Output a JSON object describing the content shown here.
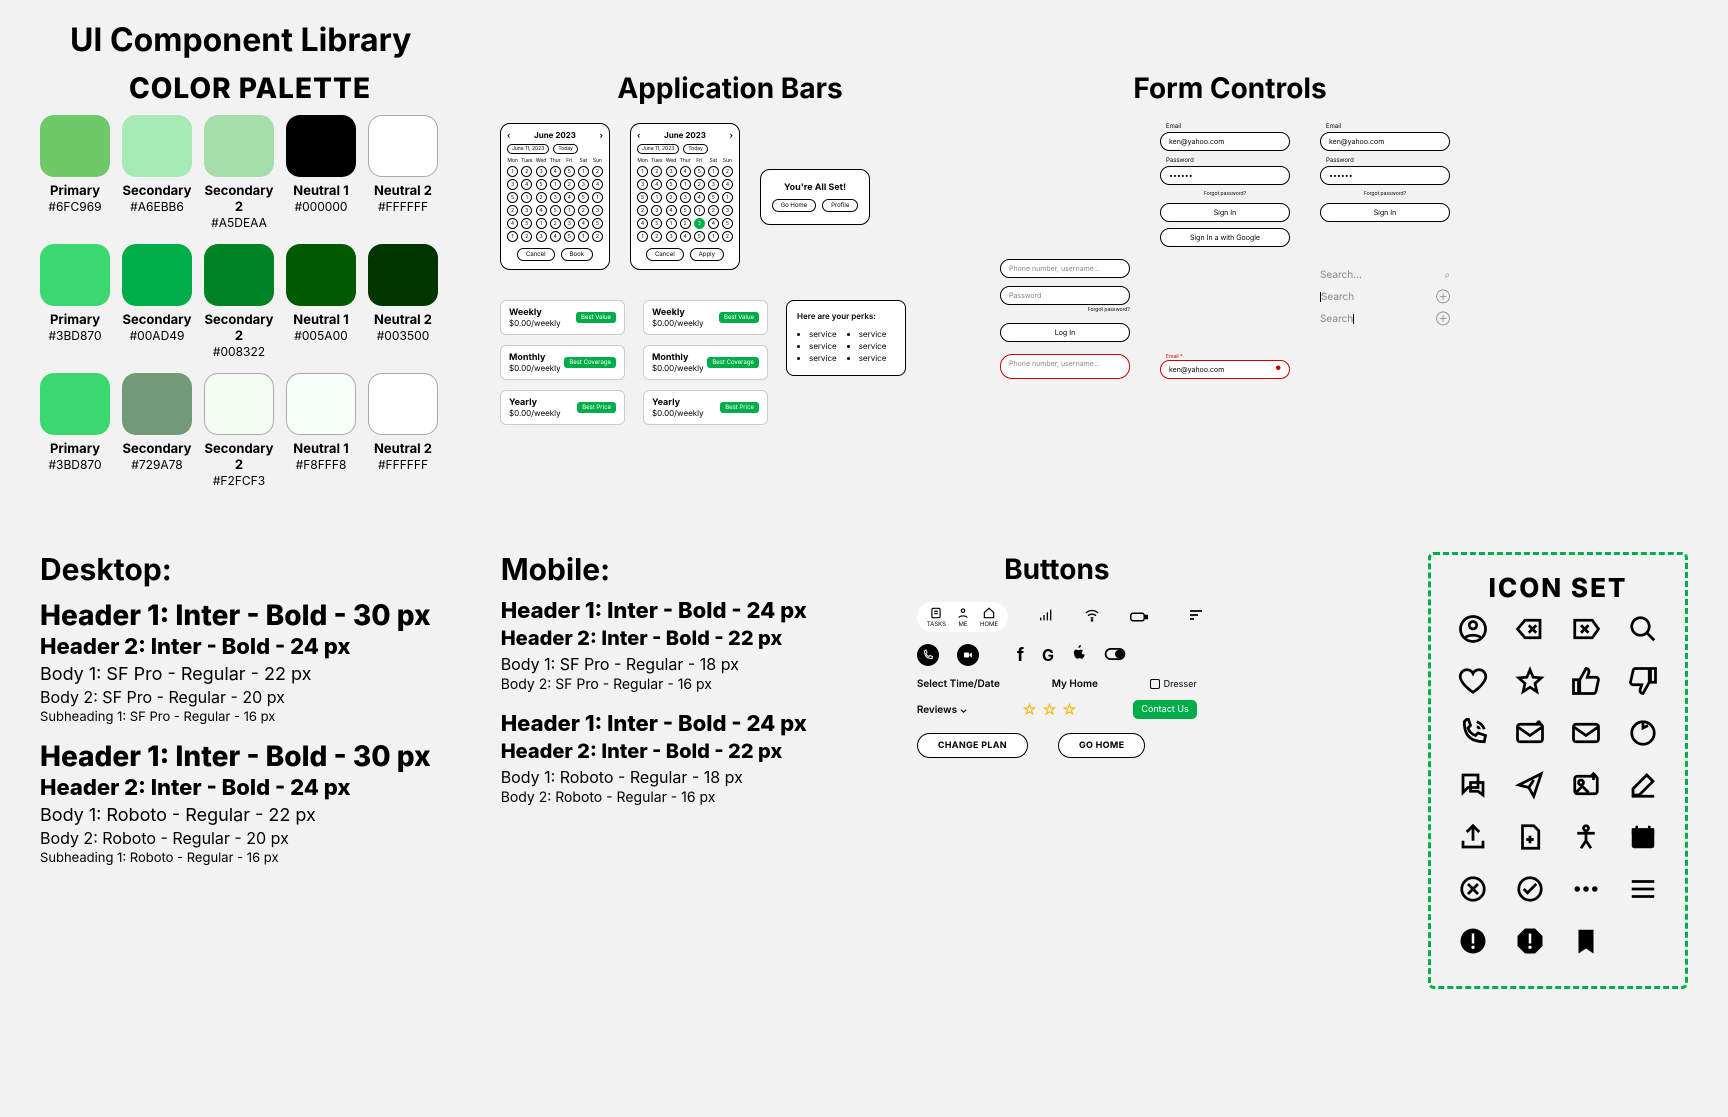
{
  "page_title": "UI Component Library",
  "palette": {
    "title": "COLOR PALETTE",
    "rows": [
      [
        {
          "name": "Primary",
          "hex": "#6FC969"
        },
        {
          "name": "Secondary",
          "hex": "#A6EBB6"
        },
        {
          "name": "Secondary 2",
          "hex": "#A5DEAA"
        },
        {
          "name": "Neutral 1",
          "hex": "#000000"
        },
        {
          "name": "Neutral 2",
          "hex": "#FFFFFF"
        }
      ],
      [
        {
          "name": "Primary",
          "hex": "#3BD870"
        },
        {
          "name": "Secondary",
          "hex": "#00AD49"
        },
        {
          "name": "Secondary 2",
          "hex": "#008322"
        },
        {
          "name": "Neutral 1",
          "hex": "#005A00"
        },
        {
          "name": "Neutral 2",
          "hex": "#003500"
        }
      ],
      [
        {
          "name": "Primary",
          "hex": "#3BD870"
        },
        {
          "name": "Secondary",
          "hex": "#729A78"
        },
        {
          "name": "Secondary 2",
          "hex": "#F2FCF3"
        },
        {
          "name": "Neutral 1",
          "hex": "#F8FFF8"
        },
        {
          "name": "Neutral 2",
          "hex": "#FFFFFF"
        }
      ]
    ]
  },
  "appbars": {
    "title": "Application Bars",
    "calendar": {
      "month": "June 2023",
      "date_label": "June 11, 2023",
      "today": "Today",
      "days": [
        "Mon",
        "Tues",
        "Wed",
        "Thur",
        "Fri",
        "Sat",
        "Sun"
      ],
      "btn_cancel": "Cancel",
      "btn_book": "Book",
      "btn_apply": "Apply"
    },
    "allset": {
      "title": "You're All Set!",
      "go_home": "Go Home",
      "profile": "Profile"
    },
    "plans": [
      {
        "title": "Weekly",
        "sub": "$0.00/weekly",
        "badge": "Best Value"
      },
      {
        "title": "Monthly",
        "sub": "$0.00/weekly",
        "badge": "Best Coverage"
      },
      {
        "title": "Yearly",
        "sub": "$0.00/weekly",
        "badge": "Best Price"
      }
    ],
    "perks": {
      "title": "Here are your perks:",
      "items": [
        "service",
        "service",
        "service",
        "service",
        "service",
        "service"
      ]
    }
  },
  "forms": {
    "title": "Form Controls",
    "email_label": "Email",
    "email_value": "ken@yahoo.com",
    "pw_label": "Password",
    "pw_value": "••••••",
    "forgot": "Forgot password?",
    "signin": "Sign In",
    "signin_google": "Sign In a with Google",
    "login": "Log In",
    "ph_user": "Phone number, username...",
    "ph_pw": "Password",
    "email_req": "Email *",
    "search_placeholder": "Search...",
    "search_word": "Search"
  },
  "typography": {
    "desktop": {
      "title": "Desktop:",
      "h1": "Header 1: Inter - Bold - 30 px",
      "h2": "Header 2: Inter - Bold - 24 px",
      "b1": "Body 1: SF Pro - Regular - 22 px",
      "b2": "Body 2: SF Pro - Regular - 20 px",
      "sub": "Subheading 1: SF Pro - Regular - 16 px",
      "h1b": "Header 1: Inter - Bold - 30 px",
      "h2b": "Header 2: Inter - Bold - 24 px",
      "b1b": "Body 1: Roboto - Regular - 22 px",
      "b2b": "Body 2: Roboto - Regular - 20 px",
      "subb": "Subheading 1: Roboto - Regular - 16 px"
    },
    "mobile": {
      "title": "Mobile:",
      "h1": "Header 1: Inter - Bold - 24 px",
      "h2": "Header 2: Inter - Bold - 22 px",
      "b1": "Body 1: SF Pro - Regular - 18 px",
      "b2": "Body 2: SF Pro - Regular - 16 px",
      "h1b": "Header 1: Inter - Bold - 24 px",
      "h2b": "Header 2: Inter - Bold - 22 px",
      "b1b": "Body 1: Roboto - Regular - 18 px",
      "b2b": "Body 2: Roboto - Regular - 16 px"
    }
  },
  "buttons": {
    "title": "Buttons",
    "nav": [
      {
        "l": "TASKS"
      },
      {
        "l": "ME"
      },
      {
        "l": "HOME"
      }
    ],
    "select_time": "Select Time/Date",
    "my_home": "My Home",
    "dresser": "Dresser",
    "reviews": "Reviews  ⌄",
    "contact": "Contact Us",
    "change_plan": "CHANGE PLAN",
    "go_home": "GO HOME"
  },
  "iconset": {
    "title": "ICON SET",
    "names": [
      "user-circle-icon",
      "backspace-icon",
      "tag-x-icon",
      "search-icon",
      "heart-icon",
      "star-icon",
      "thumbs-up-icon",
      "thumbs-down-icon",
      "phone-call-icon",
      "mail-plus-icon",
      "mail-icon",
      "refresh-icon",
      "chat-icon",
      "send-icon",
      "image-up-icon",
      "edit-icon",
      "upload-icon",
      "file-plus-icon",
      "accessibility-icon",
      "calendar-icon",
      "x-circle-icon",
      "check-circle-icon",
      "dots-icon",
      "menu-icon",
      "alert-circle-icon",
      "alert-octagon-icon",
      "bookmark-icon"
    ]
  }
}
